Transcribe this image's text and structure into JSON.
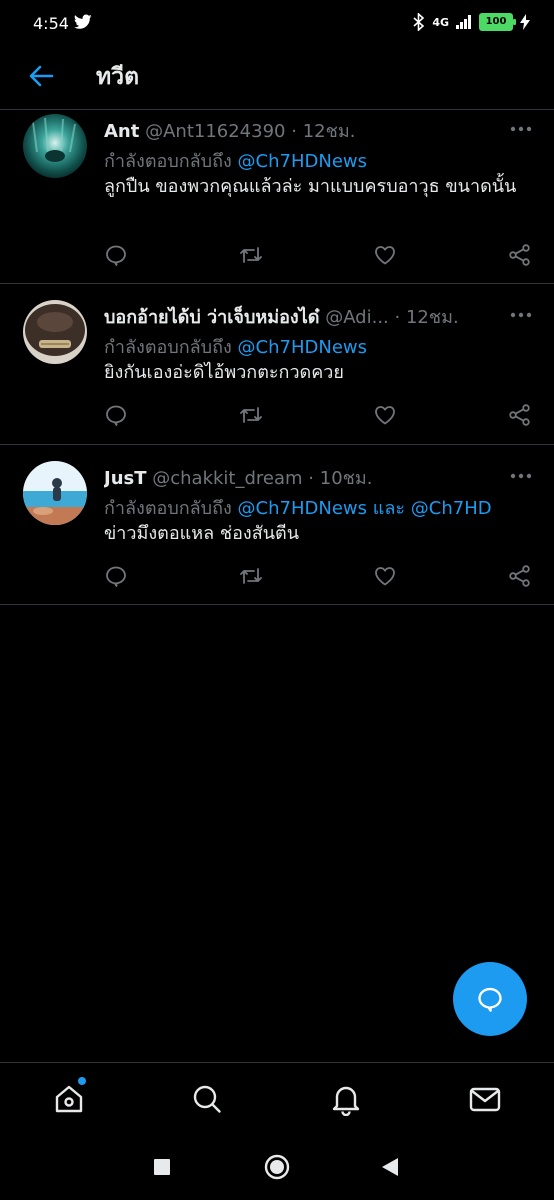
{
  "status_bar": {
    "time": "4:54",
    "network": "4G",
    "battery": "100"
  },
  "header": {
    "title": "ทวีต"
  },
  "tweets": [
    {
      "name": "Ant",
      "handle": "@Ant11624390",
      "time": "12ชม.",
      "replying_to_prefix": "กำลังตอบกลับถึง",
      "replying_to": "@Ch7HDNews",
      "replying_and": "",
      "replying_to_2": "",
      "text": "ลูกปืน ของพวกคุณแล้วล่ะ มาแบบครบอาวุธ ขนาดนั้น"
    },
    {
      "name": "บอกอ้ายได้บ่ ว่าเจ็บหม่องได๋",
      "handle": "@Adi...",
      "time": "12ชม.",
      "replying_to_prefix": "กำลังตอบกลับถึง",
      "replying_to": "@Ch7HDNews",
      "replying_and": "",
      "replying_to_2": "",
      "text": "ยิงกันเองอ่ะดิไอ้พวกตะกวดควย"
    },
    {
      "name": "JusT",
      "handle": "@chakkit_dream",
      "time": "10ชม.",
      "replying_to_prefix": "กำลังตอบกลับถึง",
      "replying_to": "@Ch7HDNews",
      "replying_and": "และ",
      "replying_to_2": "@Ch7HD",
      "text": "ข่าวมึงตอแหล ช่องสันตีน"
    }
  ],
  "colors": {
    "accent": "#1d9bf0",
    "background": "#000000",
    "muted": "#71767b",
    "divider": "#2f3336"
  },
  "icons": {
    "action_icons": [
      "reply-icon",
      "retweet-icon",
      "like-icon",
      "share-icon"
    ],
    "nav_icons": [
      "home-icon",
      "search-icon",
      "notifications-icon",
      "messages-icon"
    ],
    "fab_icon": "compose-reply-icon"
  }
}
